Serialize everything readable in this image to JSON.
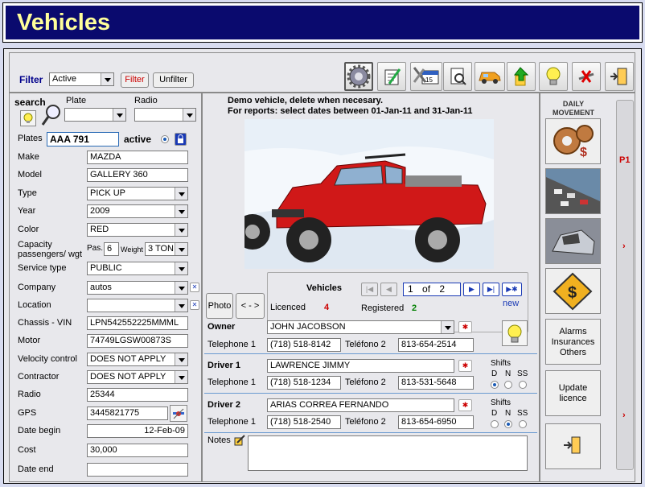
{
  "title": "Vehicles",
  "toolbar": {
    "filter_label": "Filter",
    "filter_value": "Active",
    "filter_button": "Filter",
    "unfilter_button": "Unfilter"
  },
  "search": {
    "label": "search",
    "plate_label": "Plate",
    "radio_label": "Radio"
  },
  "plates": {
    "label": "Plates",
    "value": "AAA 791",
    "active_label": "active"
  },
  "fields": {
    "make": {
      "label": "Make",
      "value": "MAZDA"
    },
    "model": {
      "label": "Model",
      "value": "GALLERY 360"
    },
    "type": {
      "label": "Type",
      "value": "PICK UP"
    },
    "year": {
      "label": "Year",
      "value": "2009"
    },
    "color": {
      "label": "Color",
      "value": "RED"
    },
    "capacity": {
      "label": "Capacity passengers/ wgt",
      "pas_label": "Pas.",
      "pas_value": "6",
      "weight_label": "Weight",
      "weight_value": "3 TON"
    },
    "service_type": {
      "label": "Service type",
      "value": "PUBLIC"
    },
    "company": {
      "label": "Company",
      "value": "autos"
    },
    "location": {
      "label": "Location",
      "value": ""
    },
    "chassis": {
      "label": "Chassis - VIN",
      "value": "LPN542552225MMML"
    },
    "motor": {
      "label": "Motor",
      "value": "74749LGSW00873S"
    },
    "velocity_control": {
      "label": "Velocity control",
      "value": "DOES NOT APPLY"
    },
    "contractor": {
      "label": "Contractor",
      "value": "DOES NOT APPLY"
    },
    "radio": {
      "label": "Radio",
      "value": "25344"
    },
    "gps": {
      "label": "GPS",
      "value": "3445821775"
    },
    "date_begin": {
      "label": "Date begin",
      "value": "12-Feb-09"
    },
    "cost": {
      "label": "Cost",
      "value": "30,000"
    },
    "date_end": {
      "label": "Date end",
      "value": ""
    }
  },
  "notice": {
    "line1": "Demo vehicle, delete when necesary.",
    "line2": "For reports: select dates between 01-Jan-11 and  31-Jan-11"
  },
  "nav": {
    "title": "Vehicles",
    "current": "1",
    "of_label": "of",
    "total": "2",
    "new_label": "new",
    "licenced_label": "Licenced",
    "licenced_count": "4",
    "registered_label": "Registered",
    "registered_count": "2"
  },
  "photo_button": "Photo",
  "swap_button": "< - >",
  "owner": {
    "label": "Owner",
    "name": "JOHN JACOBSON",
    "tel1_label": "Telephone 1",
    "tel1": "(718) 518-8142",
    "tel2_label": "Teléfono 2",
    "tel2": "813-654-2514"
  },
  "driver1": {
    "label": "Driver 1",
    "name": "LAWRENCE JIMMY",
    "tel1_label": "Telephone 1",
    "tel1": "(718) 518-1234",
    "tel2_label": "Teléfono 2",
    "tel2": "813-531-5648",
    "shifts_label": "Shifts",
    "shift_letters": [
      "D",
      "N",
      "SS"
    ]
  },
  "driver2": {
    "label": "Driver 2",
    "name": "ARIAS CORREA FERNANDO",
    "tel1_label": "Telephone 1",
    "tel1": "(718) 518-2540",
    "tel2_label": "Teléfono 2",
    "tel2": "813-654-6950",
    "shifts_label": "Shifts",
    "shift_letters": [
      "D",
      "N",
      "SS"
    ]
  },
  "notes_label": "Notes",
  "right_panel": {
    "daily_movement": "DAILY MOVEMENT",
    "alarms_button": "Alarms Insurances Others",
    "update_button": "Update licence",
    "page_label": "P1"
  },
  "colors": {
    "title_bg": "#0a0a6e",
    "title_text": "#ffff9a",
    "accent_red": "#cc0000",
    "accent_green": "#008000",
    "nav_blue": "#1a3ab5"
  }
}
